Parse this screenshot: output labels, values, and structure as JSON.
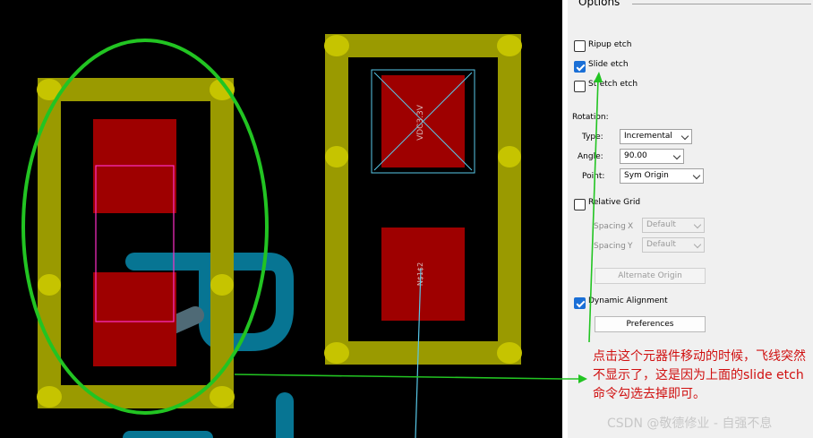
{
  "options": {
    "group_title": "Options",
    "ripup_etch": {
      "label": "Ripup etch",
      "checked": false
    },
    "slide_etch": {
      "label": "Slide etch",
      "checked": true
    },
    "stretch_etch": {
      "label": "Stretch etch",
      "checked": false
    },
    "rotation_label": "Rotation:",
    "type": {
      "label": "Type:",
      "value": "Incremental"
    },
    "angle": {
      "label": "Angle:",
      "value": "90.00"
    },
    "point": {
      "label": "Point:",
      "value": "Sym Origin"
    },
    "relative_grid": {
      "label": "Relative Grid",
      "checked": false
    },
    "spacing_x": {
      "label": "Spacing",
      "axis": "X",
      "value": "Default"
    },
    "spacing_y": {
      "label": "Spacing",
      "axis": "Y",
      "value": "Default"
    },
    "alternate_origin_label": "Alternate Origin",
    "dynamic_alignment": {
      "label": "Dynamic Alignment",
      "checked": true
    },
    "preferences_label": "Preferences"
  },
  "pcb": {
    "right_pad_label": "VDC3.3V",
    "lower_pad_label": "N$1$2"
  },
  "annotation": {
    "text": "点击这个元器件移动的时候，飞线突然不显示了，这是因为上面的slide etch命令勾选去掉即可。",
    "color": "#d01010"
  },
  "watermark": "CSDN @敬德修业 - 自强不息",
  "colors": {
    "background": "#000000",
    "silk": "#9c9c00",
    "pin": "#c8c400",
    "pad": "#9e0000",
    "ratsnest": "#58c8e8",
    "etch": "#0aa0c8",
    "highlight": "#ff30c8",
    "circle": "#20c420",
    "arrow": "#20c420"
  }
}
